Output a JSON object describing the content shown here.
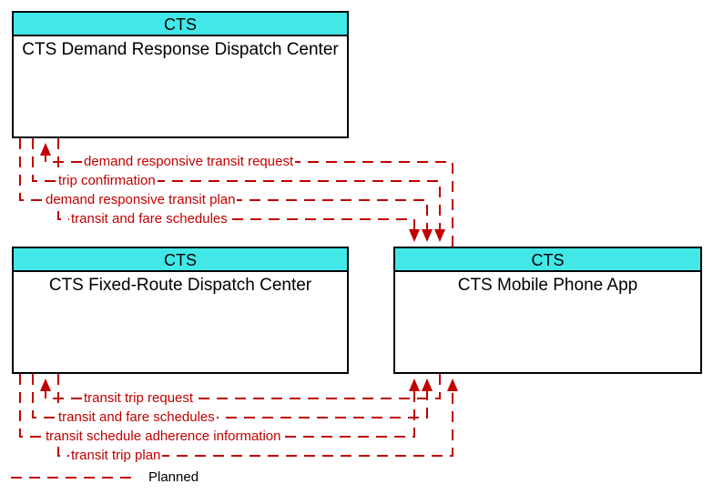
{
  "boxes": {
    "demand": {
      "header": "CTS",
      "title": "CTS Demand Response Dispatch Center"
    },
    "fixed": {
      "header": "CTS",
      "title": "CTS Fixed-Route Dispatch Center"
    },
    "mobile": {
      "header": "CTS",
      "title": "CTS Mobile Phone App"
    }
  },
  "flows": {
    "top": [
      "demand responsive transit request",
      "trip confirmation",
      "demand responsive transit plan",
      "transit and fare schedules"
    ],
    "bottom": [
      "transit trip request",
      "transit and fare schedules",
      "transit schedule adherence information",
      "transit trip plan"
    ]
  },
  "legend": {
    "planned": "Planned"
  },
  "colors": {
    "header_bg": "#42e8e8",
    "flow_line": "#c00000"
  }
}
